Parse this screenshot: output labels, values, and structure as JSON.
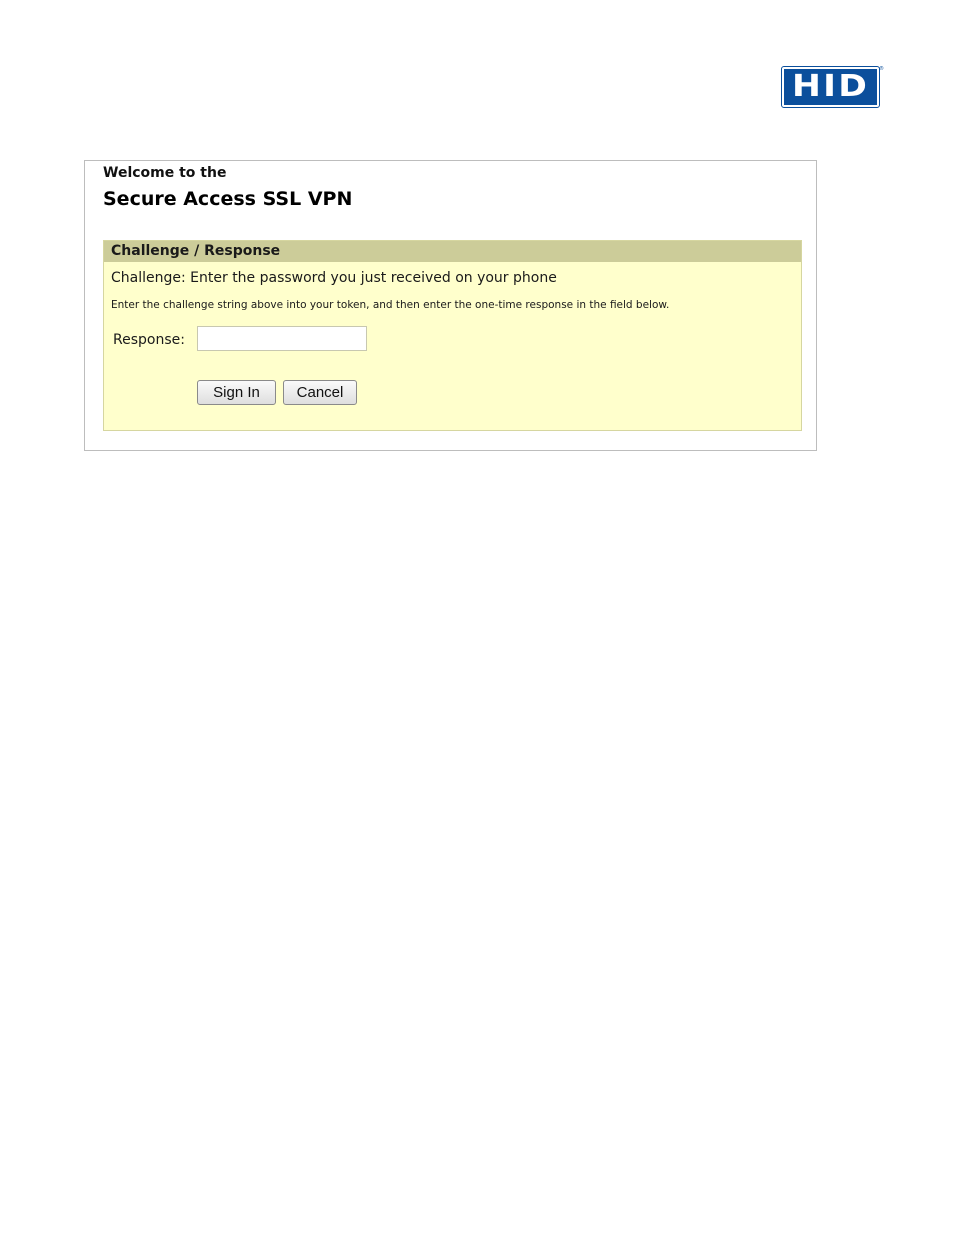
{
  "logo": {
    "text": "HID",
    "registered_mark": "®",
    "color": "#0b4f9c"
  },
  "header": {
    "welcome": "Welcome to the",
    "title": "Secure Access SSL VPN"
  },
  "panel": {
    "header": "Challenge / Response",
    "challenge": "Challenge: Enter the password you just received on your phone",
    "instructions": "Enter the challenge string above into your token, and then enter the one-time response in the field below.",
    "response_label": "Response:",
    "response_value": "",
    "header_color": "#cccc99",
    "background_color": "#ffffcc"
  },
  "buttons": {
    "sign_in": "Sign In",
    "cancel": "Cancel"
  }
}
